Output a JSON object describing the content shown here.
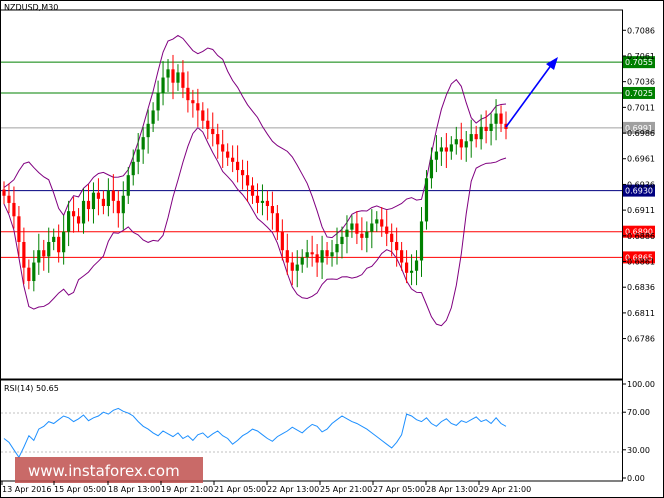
{
  "chart_data": [
    {
      "type": "candlestick",
      "title": "NZDUSD,M30",
      "y_ticks": [
        "0.7086",
        "0.7061",
        "0.7036",
        "0.7011",
        "0.6986",
        "0.6961",
        "0.6936",
        "0.6911",
        "0.6886",
        "0.6861",
        "0.6836",
        "0.6811",
        "0.6786"
      ],
      "ylim": [
        0.6771,
        0.7096
      ],
      "x_ticks": [
        "13 Apr 2016",
        "15 Apr 05:00",
        "18 Apr 13:00",
        "19 Apr 21:00",
        "21 Apr 05:00",
        "22 Apr 13:00",
        "25 Apr 21:00",
        "27 Apr 05:00",
        "28 Apr 13:00",
        "29 Apr 21:00"
      ],
      "levels": [
        {
          "value": 0.7055,
          "label": "0.7055",
          "color": "#008000"
        },
        {
          "value": 0.7025,
          "label": "0.7025",
          "color": "#008000"
        },
        {
          "value": 0.6991,
          "label": "0.6991",
          "color": "#a0a0a0"
        },
        {
          "value": 0.693,
          "label": "0.6930",
          "color": "#000080"
        },
        {
          "value": 0.689,
          "label": "0.6890",
          "color": "#ff0000"
        },
        {
          "value": 0.6865,
          "label": "0.6865",
          "color": "#ff0000"
        }
      ],
      "close": [
        0.6925,
        0.6918,
        0.6905,
        0.688,
        0.6855,
        0.6842,
        0.686,
        0.6872,
        0.6866,
        0.688,
        0.6885,
        0.687,
        0.689,
        0.691,
        0.6905,
        0.6898,
        0.692,
        0.6912,
        0.6928,
        0.6922,
        0.6915,
        0.693,
        0.692,
        0.6908,
        0.6925,
        0.6945,
        0.6958,
        0.697,
        0.6982,
        0.6995,
        0.7008,
        0.7025,
        0.704,
        0.7048,
        0.7035,
        0.7045,
        0.703,
        0.7018,
        0.7015,
        0.7008,
        0.6998,
        0.699,
        0.6985,
        0.6975,
        0.6968,
        0.6962,
        0.6958,
        0.695,
        0.6945,
        0.6935,
        0.6925,
        0.6918,
        0.692,
        0.6915,
        0.6908,
        0.689,
        0.6872,
        0.686,
        0.6852,
        0.6858,
        0.6865,
        0.687,
        0.6868,
        0.686,
        0.6872,
        0.6866,
        0.687,
        0.6878,
        0.6885,
        0.6892,
        0.6898,
        0.6888,
        0.6884,
        0.689,
        0.6898,
        0.6902,
        0.6895,
        0.6888,
        0.688,
        0.6872,
        0.686,
        0.685,
        0.6852,
        0.6862,
        0.69,
        0.6942,
        0.696,
        0.6968,
        0.6972,
        0.6968,
        0.6975,
        0.698,
        0.6972,
        0.6978,
        0.6985,
        0.698,
        0.6992,
        0.6988,
        0.6995,
        0.7005,
        0.6995,
        0.699
      ],
      "rsi": {
        "label": "RSI(14) 50.65",
        "y_ticks": [
          "100.00",
          "70.00",
          "30.00",
          "0.00"
        ],
        "ylim": [
          0,
          100
        ],
        "values": [
          42,
          38,
          30,
          22,
          33,
          45,
          40,
          52,
          55,
          60,
          58,
          62,
          66,
          64,
          60,
          63,
          67,
          61,
          64,
          66,
          70,
          68,
          72,
          74,
          71,
          69,
          66,
          60,
          55,
          52,
          48,
          45,
          50,
          47,
          44,
          48,
          42,
          45,
          40,
          46,
          48,
          43,
          47,
          50,
          45,
          42,
          36,
          40,
          45,
          48,
          52,
          50,
          46,
          42,
          39,
          44,
          47,
          50,
          54,
          51,
          48,
          53,
          57,
          55,
          49,
          52,
          58,
          62,
          66,
          63,
          60,
          58,
          55,
          52,
          48,
          44,
          40,
          36,
          32,
          38,
          46,
          68,
          66,
          62,
          60,
          64,
          58,
          55,
          60,
          63,
          58,
          56,
          61,
          59,
          62,
          65,
          60,
          62,
          58,
          64,
          58,
          55
        ]
      },
      "watermark": "www.instaforex.com",
      "colors": {
        "bull": "#008000",
        "bear": "#ff0000",
        "band": "#800080",
        "rsi": "#1e90ff",
        "arrow": "#0000ff"
      }
    }
  ]
}
